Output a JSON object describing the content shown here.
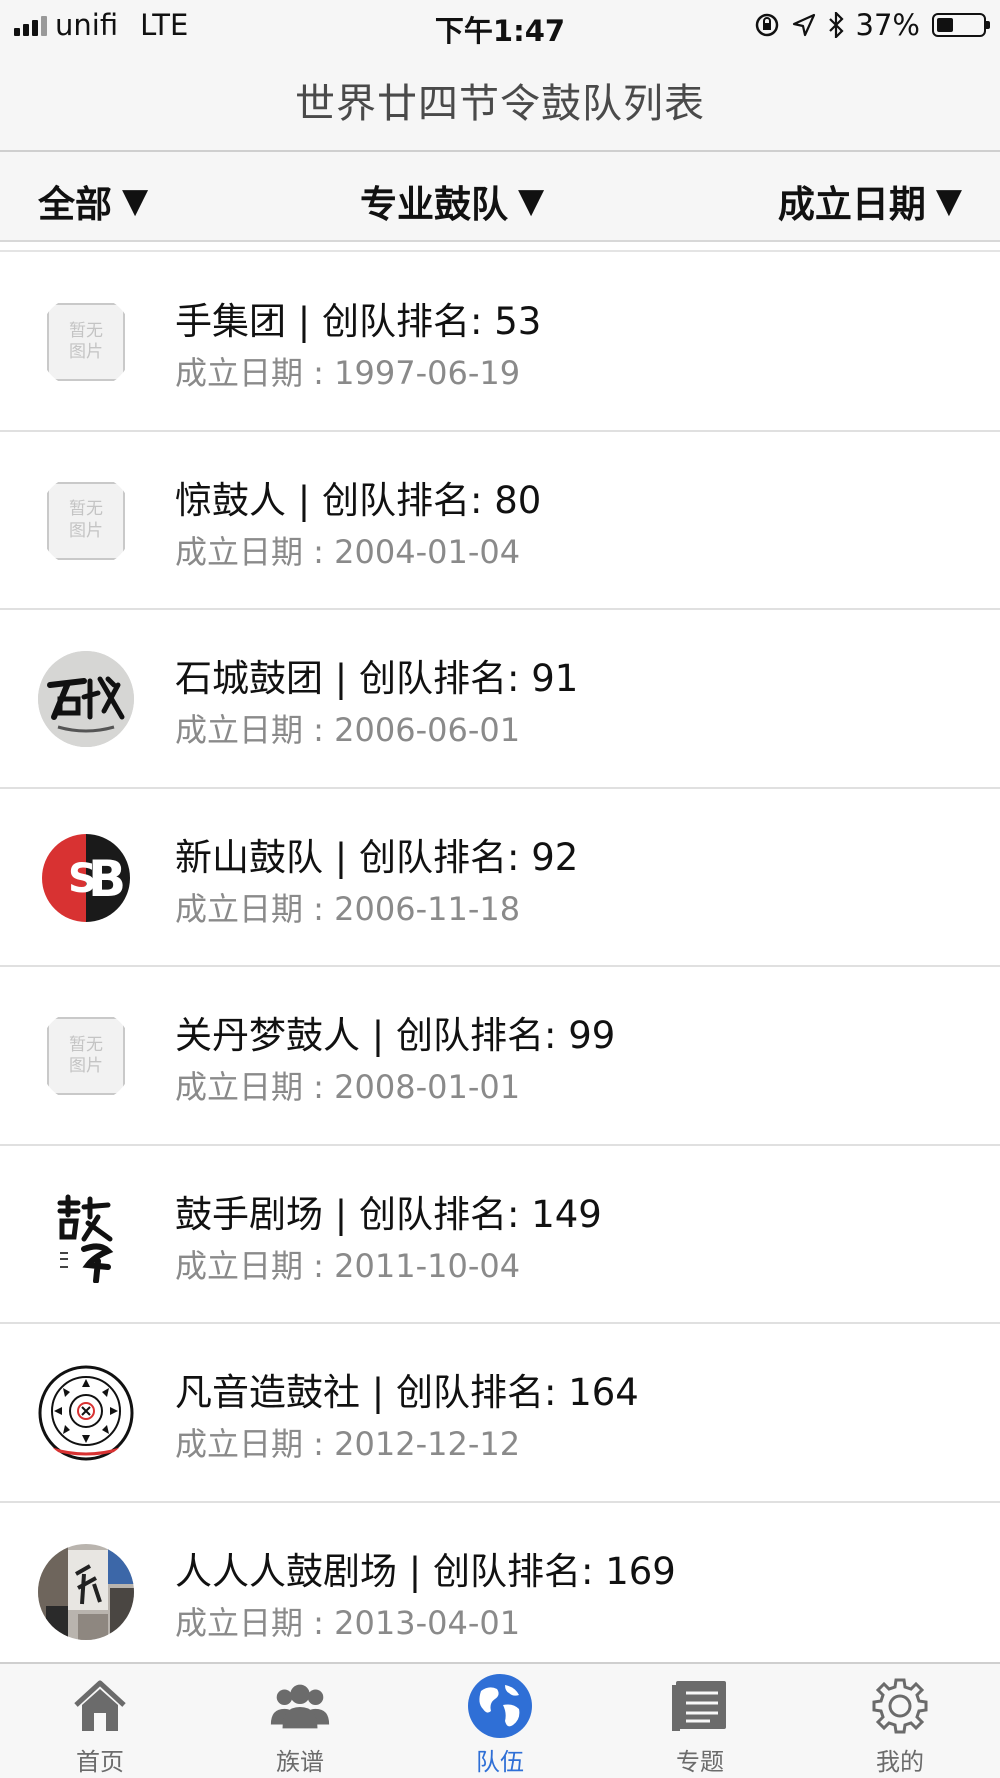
{
  "status_bar": {
    "carrier": "unifi",
    "network": "LTE",
    "time": "下午1:47",
    "battery": "37%",
    "battery_level": 0.37
  },
  "nav": {
    "title": "世界廿四节令鼓队列表"
  },
  "filters": {
    "all": "全部",
    "type": "专业鼓队",
    "sort": "成立日期",
    "arrow": "▼"
  },
  "list": [
    {
      "name": "手集团 | 创队排名: 53",
      "date": "成立日期 : 1997-06-19",
      "avatar": "placeholder"
    },
    {
      "name": "惊鼓人 | 创队排名: 80",
      "date": "成立日期 : 2004-01-04",
      "avatar": "placeholder"
    },
    {
      "name": "石城鼓团 | 创队排名: 91",
      "date": "成立日期 : 2006-06-01",
      "avatar": "shicheng-logo"
    },
    {
      "name": "新山鼓队 | 创队排名: 92",
      "date": "成立日期 : 2006-11-18",
      "avatar": "sb-logo"
    },
    {
      "name": "关丹梦鼓人 | 创队排名: 99",
      "date": "成立日期 : 2008-01-01",
      "avatar": "placeholder"
    },
    {
      "name": "鼓手剧场 | 创队排名: 149",
      "date": "成立日期 : 2011-10-04",
      "avatar": "calligraphy-logo"
    },
    {
      "name": "凡音造鼓社 | 创队排名: 164",
      "date": "成立日期 : 2012-12-12",
      "avatar": "emblem-logo"
    },
    {
      "name": "人人人鼓剧场 | 创队排名: 169",
      "date": "成立日期 : 2013-04-01",
      "avatar": "photo"
    }
  ],
  "placeholder_text": {
    "line1": "暂无",
    "line2": "图片"
  },
  "tabs": [
    {
      "label": "首页",
      "icon": "home-icon"
    },
    {
      "label": "族谱",
      "icon": "people-icon"
    },
    {
      "label": "队伍",
      "icon": "globe-icon",
      "active": true
    },
    {
      "label": "专题",
      "icon": "document-icon"
    },
    {
      "label": "我的",
      "icon": "gear-icon"
    }
  ],
  "colors": {
    "accent": "#2f6fd6",
    "text_secondary": "#8a8a8a",
    "logo_red": "#d83232"
  }
}
